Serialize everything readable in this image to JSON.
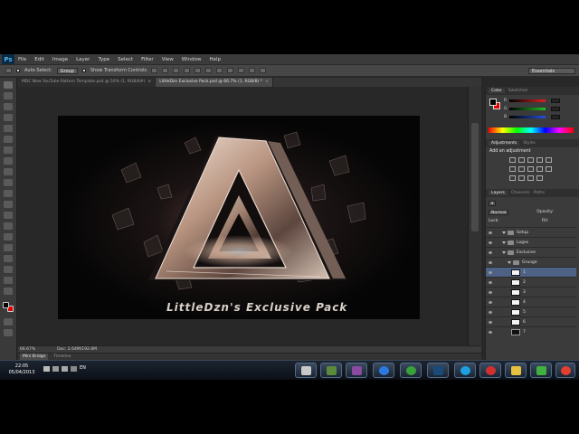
{
  "app": {
    "logo": "Ps",
    "menu": [
      "File",
      "Edit",
      "Image",
      "Layer",
      "Type",
      "Select",
      "Filter",
      "View",
      "Window",
      "Help"
    ]
  },
  "options_bar": {
    "auto_select_label": "Auto-Select:",
    "auto_select_value": "Group",
    "show_transform_label": "Show Transform Controls",
    "workspace": "Essentials"
  },
  "document_tabs": [
    {
      "label": "MDC New YouTube Pattern Template.psd @ 50% (1, RGB/8#)",
      "active": false
    },
    {
      "label": "LittleDzn Exclusive Pack.psd @ 66.7% (1, RGB/8) *",
      "active": true
    }
  ],
  "canvas": {
    "caption": "LittleDzn's Exclusive Pack"
  },
  "status_bar": {
    "zoom": "66.67%",
    "doc_size": "Doc: 2.64M/192.6M"
  },
  "mini_bridge": {
    "tabs": [
      "Mini Bridge",
      "Timeline"
    ]
  },
  "panels": {
    "color_tabs": [
      "Color",
      "Swatches"
    ],
    "color_channels": [
      {
        "channel": "R",
        "value": "0",
        "color": "#e02020"
      },
      {
        "channel": "G",
        "value": "0",
        "color": "#20c020"
      },
      {
        "channel": "B",
        "value": "0",
        "color": "#2050e0"
      }
    ],
    "adjust_tabs": [
      "Adjustments",
      "Styles"
    ],
    "adjust_title": "Add an adjustment",
    "layers_tabs": [
      "Layers",
      "Channels",
      "Paths"
    ],
    "blend_mode": "Normal",
    "opacity_label": "Opacity:",
    "lock_label": "Lock:",
    "fill_label": "Fill:",
    "layers": [
      {
        "name": "Setup",
        "type": "group",
        "indent": 1
      },
      {
        "name": "Logos",
        "type": "group",
        "indent": 1
      },
      {
        "name": "Exclusive",
        "type": "group-open",
        "indent": 1
      },
      {
        "name": "Grunge",
        "type": "group-open",
        "indent": 2
      },
      {
        "name": "1",
        "type": "layer-white",
        "indent": 3,
        "selected": true
      },
      {
        "name": "2",
        "type": "layer-white",
        "indent": 3
      },
      {
        "name": "3",
        "type": "layer-white",
        "indent": 3
      },
      {
        "name": "4",
        "type": "layer-white",
        "indent": 3
      },
      {
        "name": "5",
        "type": "layer-white",
        "indent": 3
      },
      {
        "name": "6",
        "type": "layer-white",
        "indent": 3
      },
      {
        "name": "7",
        "type": "layer-black",
        "indent": 3
      }
    ]
  },
  "taskbar": {
    "time": "22:05",
    "date": "05/04/2013",
    "language": "EN",
    "apps": [
      {
        "name": "paint-icon",
        "color": "#c8c8c8"
      },
      {
        "name": "minecraft-icon",
        "color": "#5a8a3a"
      },
      {
        "name": "winrar-icon",
        "color": "#8a4aa0"
      },
      {
        "name": "internet-explorer-icon",
        "color": "#2a7ae0"
      },
      {
        "name": "utorrent-icon",
        "color": "#3aa03a"
      },
      {
        "name": "photoshop-icon",
        "color": "#1a4a7a"
      },
      {
        "name": "skype-icon",
        "color": "#1ea0e0"
      },
      {
        "name": "ccleaner-icon",
        "color": "#d03030"
      },
      {
        "name": "explorer-folder-icon",
        "color": "#e8c040"
      },
      {
        "name": "bittorrent-icon",
        "color": "#40b040"
      },
      {
        "name": "chrome-icon",
        "color": "#e04030"
      }
    ]
  }
}
